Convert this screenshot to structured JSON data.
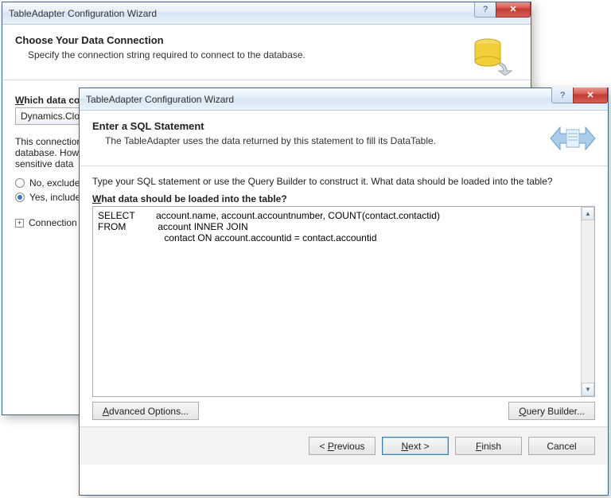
{
  "back": {
    "title": "TableAdapter Configuration Wizard",
    "header_title": "Choose Your Data Connection",
    "header_sub": "Specify the connection string required to connect to the database.",
    "which_label": "Which data connection",
    "combo_value": "Dynamics.Clo",
    "desc_line1": "This connection",
    "desc_line2": "database. How",
    "desc_line3": "sensitive data",
    "radio_no": "No, exclude",
    "radio_yes": "Yes, include",
    "conn_toggle": "Connection"
  },
  "front": {
    "title": "TableAdapter Configuration Wizard",
    "header_title": "Enter a SQL Statement",
    "header_sub": "The TableAdapter uses the data returned by this statement to fill its DataTable.",
    "instr": "Type your SQL statement or use the Query Builder to construct it. What data should be loaded into the table?",
    "field_label": "What data should be loaded into the table?",
    "sql": "SELECT        account.name, account.accountnumber, COUNT(contact.contactid)\nFROM            account INNER JOIN\n                         contact ON account.accountid = contact.accountid",
    "btn_advanced": "Advanced Options...",
    "btn_query": "Query Builder...",
    "btn_prev": "< Previous",
    "btn_next": "Next >",
    "btn_finish": "Finish",
    "btn_cancel": "Cancel"
  }
}
